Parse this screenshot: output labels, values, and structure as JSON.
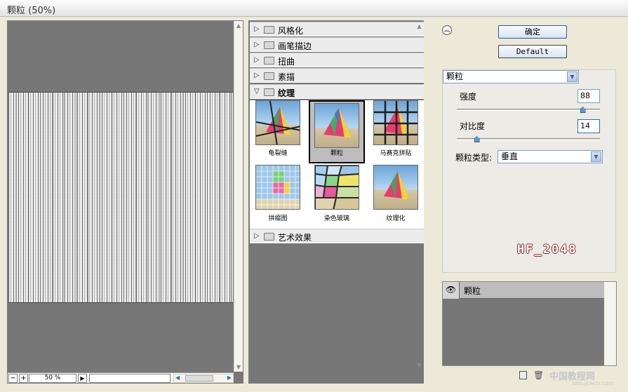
{
  "window": {
    "title": "颗粒 (50%)"
  },
  "preview": {
    "zoom": "50 %",
    "zoom_out": "−",
    "zoom_in": "+"
  },
  "filters": {
    "categories": [
      {
        "label": "风格化",
        "expanded": false
      },
      {
        "label": "画笔描边",
        "expanded": false
      },
      {
        "label": "扭曲",
        "expanded": false
      },
      {
        "label": "素描",
        "expanded": false
      },
      {
        "label": "纹理",
        "expanded": true
      },
      {
        "label": "艺术效果",
        "expanded": false
      }
    ],
    "texture_items": [
      {
        "label": "龟裂缝",
        "selected": false
      },
      {
        "label": "颗粒",
        "selected": true
      },
      {
        "label": "马赛克拼贴",
        "selected": false
      },
      {
        "label": "拼缀图",
        "selected": false
      },
      {
        "label": "染色玻璃",
        "selected": false
      },
      {
        "label": "纹理化",
        "selected": false
      }
    ]
  },
  "buttons": {
    "ok": "确定",
    "default": "Default"
  },
  "settings": {
    "filter_select": "颗粒",
    "intensity_label": "强度",
    "intensity_value": "88",
    "intensity_fraction": 0.88,
    "contrast_label": "对比度",
    "contrast_value": "14",
    "contrast_fraction": 0.14,
    "grain_type_label": "颗粒类型:",
    "grain_type_value": "垂直"
  },
  "watermark": "HF_2048",
  "layers": [
    {
      "name": "颗粒",
      "visible": true
    }
  ],
  "site": {
    "name": "中国教程网",
    "url": "bbs.jcwcn.com"
  },
  "colors": {
    "accent": "#2d5a9a",
    "panel_gray": "#777777",
    "logo_outline": "#8a1e1e"
  }
}
